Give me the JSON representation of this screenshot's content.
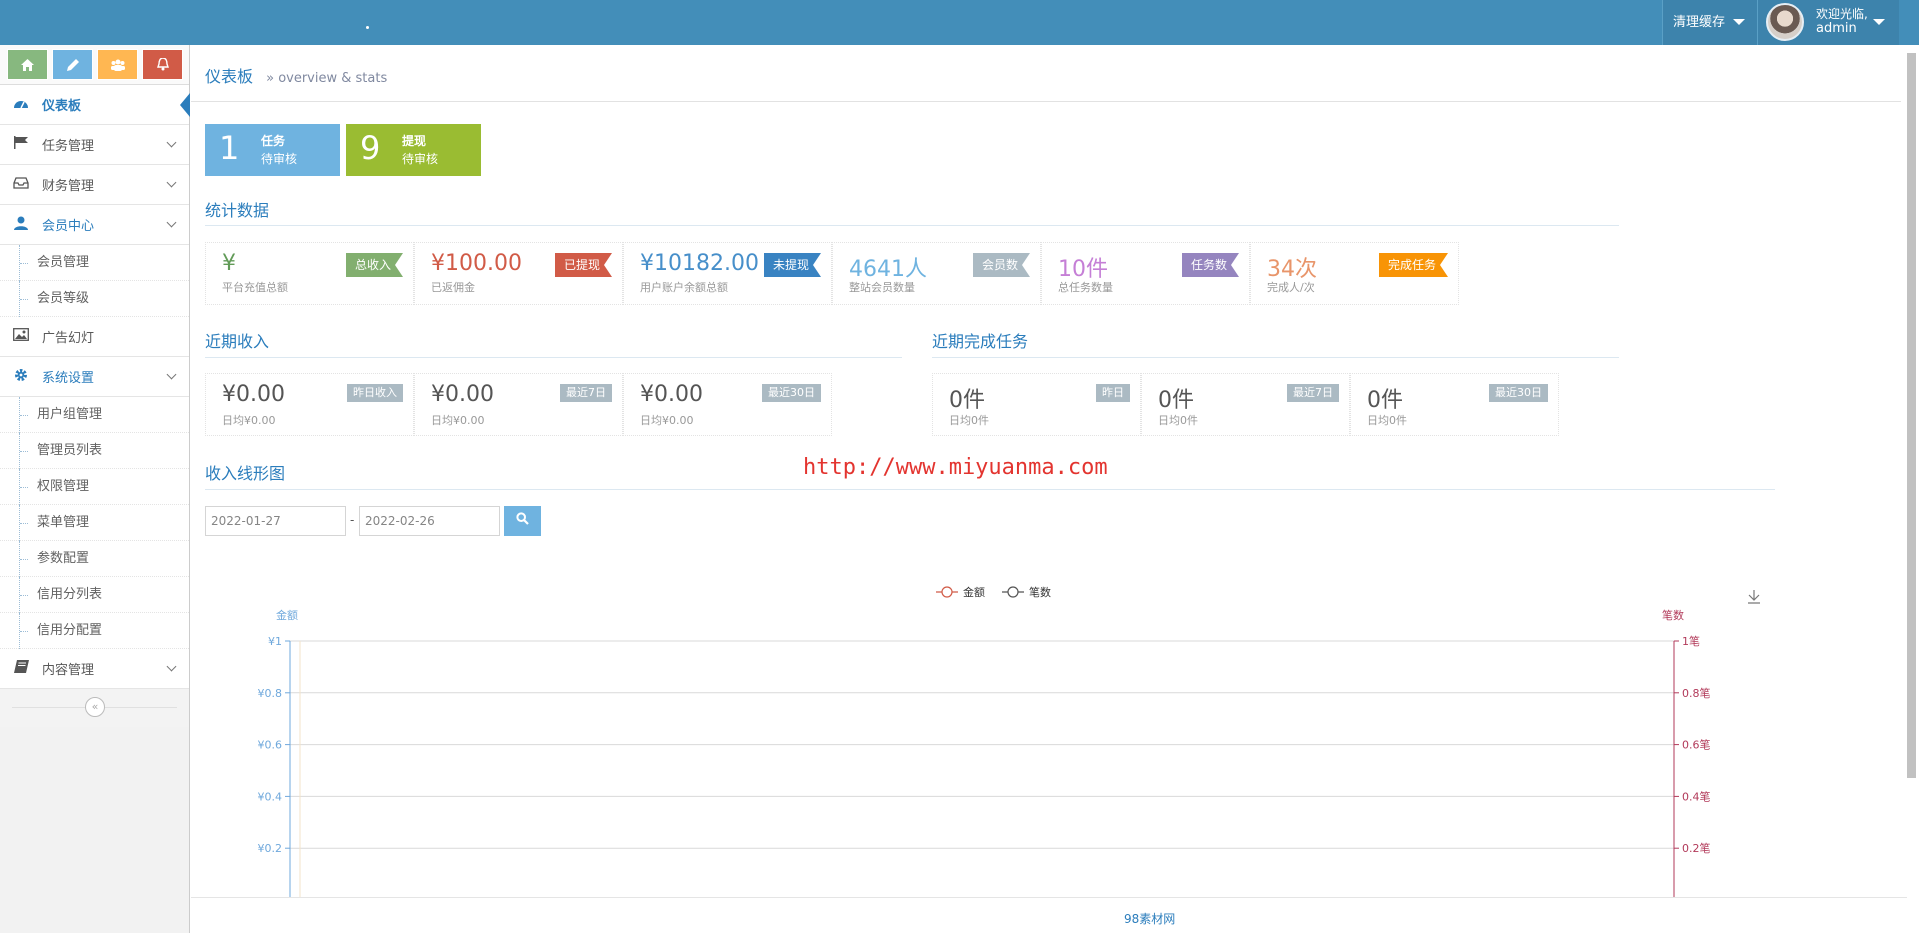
{
  "navbar": {
    "cache_label": "清理缓存",
    "welcome": "欢迎光临,",
    "username": "admin"
  },
  "sidebar": {
    "shortcuts": [
      {
        "icon": "home-icon",
        "color": "#87b87f"
      },
      {
        "icon": "pencil-icon",
        "color": "#6fb3e0"
      },
      {
        "icon": "group-icon",
        "color": "#ffb752"
      },
      {
        "icon": "bell-icon",
        "color": "#d15b47"
      }
    ],
    "items": {
      "dashboard": "仪表板",
      "tasks": "任务管理",
      "finance": "财务管理",
      "members": "会员中心",
      "member_manage": "会员管理",
      "member_level": "会员等级",
      "ads": "广告幻灯",
      "settings": "系统设置",
      "user_group": "用户组管理",
      "admin_list": "管理员列表",
      "permissions": "权限管理",
      "menu": "菜单管理",
      "params": "参数配置",
      "credit_list": "信用分列表",
      "credit_config": "信用分配置",
      "content": "内容管理"
    }
  },
  "breadcrumb": {
    "title": "仪表板",
    "subtitle": "» overview & stats"
  },
  "pending": [
    {
      "num": "1",
      "label": "任务",
      "status": "待审核",
      "color": "#6fb3e0"
    },
    {
      "num": "9",
      "label": "提现",
      "status": "待审核",
      "color": "#9abc32"
    }
  ],
  "stats_title": "统计数据",
  "stats": [
    {
      "value": "¥",
      "sub": "平台充值总额",
      "ribbon": "总收入",
      "value_color": "#629b58",
      "ribbon_color": "#82af6f"
    },
    {
      "value": "¥100.00",
      "sub": "已返佣金",
      "ribbon": "已提现",
      "value_color": "#d15b47",
      "ribbon_color": "#d15b47"
    },
    {
      "value": "¥10182.00",
      "sub": "用户账户余额总额",
      "ribbon": "未提现",
      "value_color": "#478fca",
      "ribbon_color": "#3983c2"
    },
    {
      "value": "4641人",
      "sub": "整站会员数量",
      "ribbon": "会员数",
      "value_color": "#6fb3e0",
      "ribbon_color": "#abbac3"
    },
    {
      "value": "10件",
      "sub": "总任务数量",
      "ribbon": "任务数",
      "value_color": "#c57fd6",
      "ribbon_color": "#9585bf"
    },
    {
      "value": "34次",
      "sub": "完成人/次",
      "ribbon": "完成任务",
      "value_color": "#e8956a",
      "ribbon_color": "#f89406"
    }
  ],
  "income_title": "近期收入",
  "income": [
    {
      "value": "¥0.00",
      "sub": "日均¥0.00",
      "tag": "昨日收入"
    },
    {
      "value": "¥0.00",
      "sub": "日均¥0.00",
      "tag": "最近7日"
    },
    {
      "value": "¥0.00",
      "sub": "日均¥0.00",
      "tag": "最近30日"
    }
  ],
  "tasks_title": "近期完成任务",
  "tasks": [
    {
      "value": "0件",
      "sub": "日均0件",
      "tag": "昨日"
    },
    {
      "value": "0件",
      "sub": "日均0件",
      "tag": "最近7日"
    },
    {
      "value": "0件",
      "sub": "日均0件",
      "tag": "最近30日"
    }
  ],
  "chart_section_title": "收入线形图",
  "watermark": "http://www.miyuanma.com",
  "date_from": "2022-01-27",
  "date_sep": "-",
  "date_to": "2022-02-26",
  "footer": "98素材网",
  "chart_data": {
    "type": "line",
    "legend": [
      "金额",
      "笔数"
    ],
    "legend_position": "top-center",
    "y_left_label": "金额",
    "y_right_label": "笔数",
    "y_left_ticks": [
      "¥1",
      "¥0.8",
      "¥0.6",
      "¥0.4",
      "¥0.2"
    ],
    "y_right_ticks": [
      "1笔",
      "0.8笔",
      "0.6笔",
      "0.4笔",
      "0.2笔"
    ],
    "ylim": [
      0,
      1
    ],
    "series": [
      {
        "name": "金额",
        "values": [],
        "color": "#d15b47"
      },
      {
        "name": "笔数",
        "values": [],
        "color": "#555555"
      }
    ],
    "grid": true,
    "left_axis_color": "#6fa8dc",
    "right_axis_color": "#b23a5a"
  }
}
